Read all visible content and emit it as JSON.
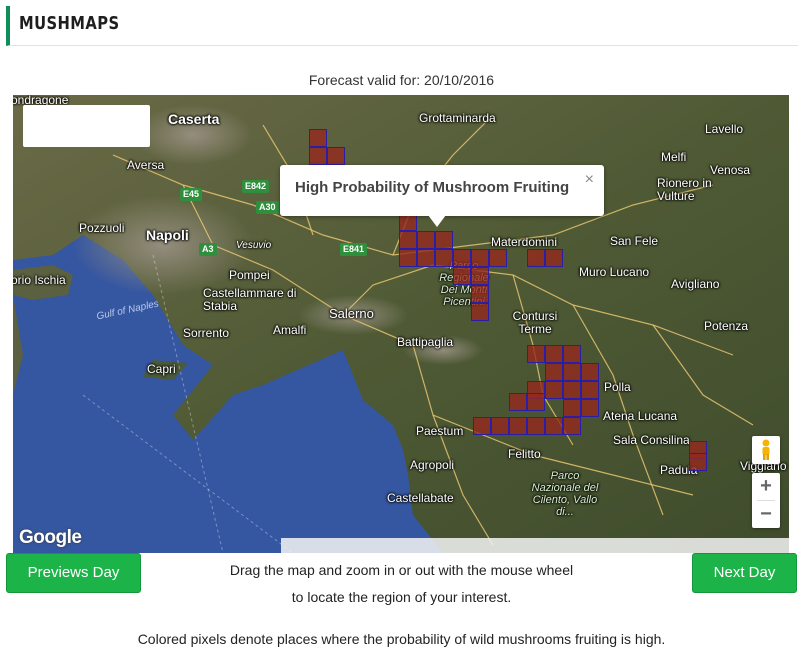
{
  "header": {
    "title": "MUSHMAPS"
  },
  "forecast": {
    "label": "Forecast valid for: 20/10/2016"
  },
  "map": {
    "tooltip": {
      "title": "High Probability of Mushroom Fruiting",
      "close": "×"
    },
    "brand": "Google",
    "zoom_in": "+",
    "zoom_out": "−",
    "place_labels": [
      "ondragone",
      "Caserta",
      "Grottaminarda",
      "Lavello",
      "Aversa",
      "Melfi",
      "Venosa",
      "Rionero in Vulture",
      "Pozzuoli",
      "Napoli",
      "Vesuvio",
      "Materdomini",
      "San Fele",
      "orio Ischia",
      "Pompei",
      "Castellammare di Stabia",
      "Muro Lucano",
      "Avigliano",
      "Gulf of Naples",
      "Sorrento",
      "Amalfi",
      "Salerno",
      "Contursi Terme",
      "Potenza",
      "Battipaglia",
      "Capri",
      "Polla",
      "Atena Lucana",
      "Paestum",
      "Sala Consilina",
      "Felitto",
      "Padula",
      "Viggiano",
      "Agropoli",
      "Castellabate"
    ],
    "park_labels": [
      "Parco Regionale Dei Monti Picentini",
      "Parco Nazionale del Cilento, Vallo di..."
    ],
    "road_labels": [
      "E45",
      "E842",
      "A30",
      "A3",
      "E841"
    ]
  },
  "buttons": {
    "prev": "Previews Day",
    "next": "Next Day"
  },
  "help": {
    "line1": "Drag the map and zoom in or out with the mouse wheel",
    "line2": "to locate the region of your interest."
  },
  "footer": {
    "text": "Colored pixels denote places where the probability of wild mushrooms fruiting is high."
  },
  "colors": {
    "accent": "#0e8f5a",
    "button": "#1cb349",
    "cell_fill": "#962820",
    "cell_border": "#2a1ea8"
  }
}
